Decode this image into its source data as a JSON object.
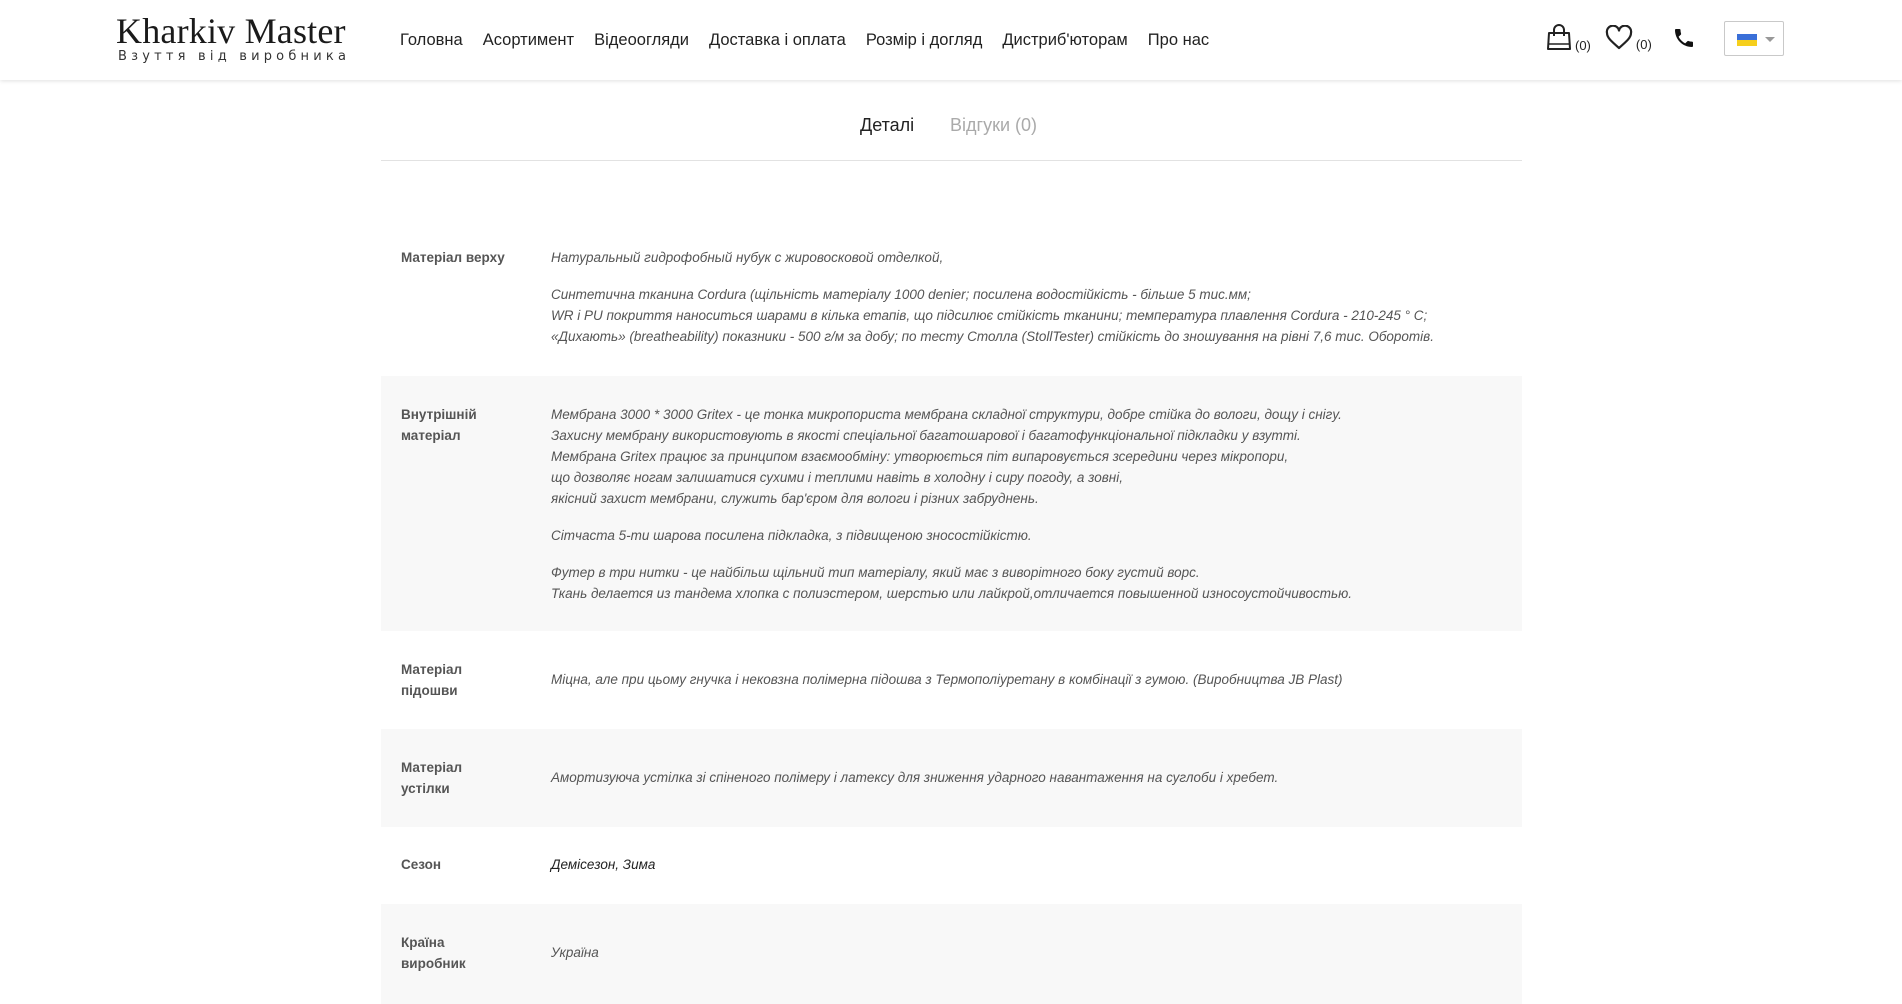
{
  "header": {
    "logo_title": "Kharkiv Master",
    "logo_subtitle": "Взуття від виробника",
    "nav": [
      {
        "label": "Головна"
      },
      {
        "label": "Асортимент"
      },
      {
        "label": "Відеоогляди"
      },
      {
        "label": "Доставка і оплата"
      },
      {
        "label": "Розмір і догляд"
      },
      {
        "label": "Дистриб'юторам"
      },
      {
        "label": "Про нас"
      }
    ],
    "cart_count": "(0)",
    "wishlist_count": "(0)",
    "language_flag_colors": [
      "#3a6fd8",
      "#f6cf1c"
    ]
  },
  "tabs": {
    "details": "Деталі",
    "reviews": "Відгуки (0)"
  },
  "details": [
    {
      "label": "Матеріал верху",
      "paragraphs": [
        [
          "Натуральный гидрофобный нубук с жировосковой отделкой,"
        ],
        [
          "Синтетична тканина Cordura (щільність матеріалу 1000 denier; посилена водостійкість - більше 5 тис.мм;",
          "WR і PU покриття наноситься шарами в кілька етапів, що підсилює стійкість тканини; температура плавлення Cordura - 210-245 ° C;",
          "«Дихають» (breatheability) показники - 500 г/м за добу; по тесту Столла (StollTester) стійкість до зношування на рівні 7,6 тис. Оборотів."
        ]
      ]
    },
    {
      "label": "Внутрішній матеріал",
      "paragraphs": [
        [
          "Мембрана 3000 * 3000 Gritex - це тонка микропориста мембрана складної структури, добре стійка до вологи, дощу і снігу.",
          "Захисну мембрану використовують в якості спеціальної багатошарової і багатофункціональної підкладки у взутті.",
          "Мембрана Gritex працює за принципом взаємообміну: утворюється піт випаровується зсередини через мікропори,",
          "що дозволяє ногам залишатися сухими і теплими навіть в холодну і сиру погоду, а зовні,",
          "якісний захист мембрани, служить бар'єром для вологи і різних забруднень."
        ],
        [
          "Сітчаста 5-ти шарова посилена підкладка, з підвищеною зносостійкістю."
        ],
        [
          "Футер в три нитки - це найбільш щільний тип матеріалу, який має з виворітного боку густий ворс.",
          "Ткань делается из тандема хлопка с полиэстером, шерстью или лайкрой,отличается повышенной износоустойчивостью."
        ]
      ]
    },
    {
      "label": "Матеріал підошви",
      "paragraphs": [
        [
          "Міцна, але при цьому гнучка і нековзна полімерна підошва з Термополіуретану в комбінації з гумою. (Виробництва JB Plast)"
        ]
      ]
    },
    {
      "label": "Матеріал устілки",
      "paragraphs": [
        [
          "Амортизуюча устілка зі спіненого полімеру і латексу для зниження ударного навантаження на суглоби і хребет."
        ]
      ]
    },
    {
      "label": "Сезон",
      "paragraphs": [
        [
          "Демісезон, Зима"
        ]
      ]
    },
    {
      "label": "Країна виробник",
      "paragraphs": [
        [
          "Україна"
        ]
      ]
    }
  ]
}
